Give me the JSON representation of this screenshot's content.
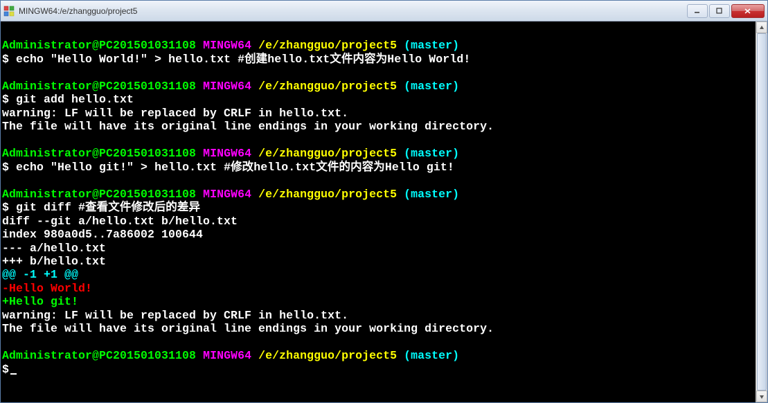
{
  "window": {
    "title": "MINGW64:/e/zhangguo/project5"
  },
  "prompt": {
    "user_host": "Administrator@PC201501031108",
    "env": "MINGW64",
    "path": "/e/zhangguo/project5",
    "branch": "(master)",
    "symbol": "$"
  },
  "cmd1": {
    "text": "echo \"Hello World!\" > hello.txt #创建hello.txt文件内容为Hello World!"
  },
  "cmd2": {
    "text": "git add hello.txt"
  },
  "out2a": "warning: LF will be replaced by CRLF in hello.txt.",
  "out2b": "The file will have its original line endings in your working directory.",
  "cmd3": {
    "text": "echo \"Hello git!\" > hello.txt #修改hello.txt文件的内容为Hello git!"
  },
  "cmd4": {
    "text": "git diff #查看文件修改后的差异"
  },
  "diff": {
    "header": "diff --git a/hello.txt b/hello.txt",
    "index": "index 980a0d5..7a86002 100644",
    "minus_file": "--- a/hello.txt",
    "plus_file": "+++ b/hello.txt",
    "hunk": "@@ -1 +1 @@",
    "removed": "-Hello World!",
    "added": "+Hello git!"
  },
  "out4a": "warning: LF will be replaced by CRLF in hello.txt.",
  "out4b": "The file will have its original line endings in your working directory."
}
